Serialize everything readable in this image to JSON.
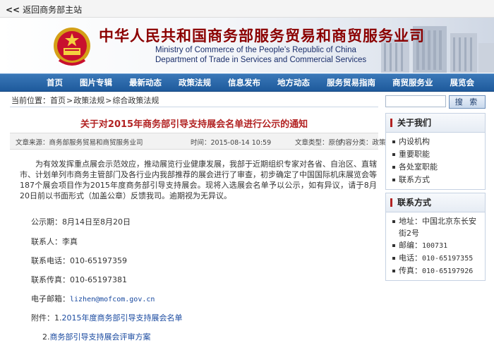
{
  "topbar": {
    "back_label": "返回商务部主站"
  },
  "header": {
    "title_cn": "中华人民共和国商务部服务贸易和商贸服务业司",
    "title_en_line1": "Ministry of Commerce of the People’s Republic of China",
    "title_en_line2": "Department of Trade in Services and Commercial Services"
  },
  "nav": {
    "items": [
      "首页",
      "图片专辑",
      "最新动态",
      "政策法规",
      "信息发布",
      "地方动态",
      "服务贸易指南",
      "商贸服务业",
      "展览会"
    ]
  },
  "breadcrumb": {
    "prefix": "当前位置：",
    "items": [
      "首页",
      "政策法规",
      "综合政策法规"
    ],
    "sep": ">"
  },
  "search": {
    "button_label": "搜 索",
    "placeholder": ""
  },
  "article": {
    "title": "关于对2015年商务部引导支持展会名单进行公示的通知",
    "source": "文章来源：商务部服务贸易和商贸服务业司",
    "time": "时间：2015-08-14 10:59",
    "type": "文章类型：原创",
    "category": "内容分类：政策",
    "body": "为有效发挥重点展会示范效应，推动展览行业健康发展，我部于近期组织专家对各省、自治区、直辖市、计划单列市商务主管部门及各行业内我部推荐的展会进行了审查，初步确定了中国国际机床展览会等187个展会项目作为2015年度商务部引导支持展会。现将入选展会名单予以公示，如有异议，请于8月20日前以书面形式（加盖公章）反馈我司。逾期视为无异议。",
    "period": "公示期：8月14日至8月20日",
    "contact": "联系人：李真",
    "phone": "联系电话：010-65197359",
    "fax": "联系传真：010-65197381",
    "email_label": "电子邮箱：",
    "email": "lizhen@mofcom.gov.cn",
    "attach_label": "附件：1.",
    "attach1": "2015年度商务部引导支持展会名单",
    "attach2_prefix": "2.",
    "attach2": "商务部引导支持展会评审方案"
  },
  "sidebar": {
    "about": {
      "title": "关于我们",
      "items": [
        "内设机构",
        "重要职能",
        "各处室职能",
        "联系方式"
      ]
    },
    "contact": {
      "title": "联系方式",
      "address": "地址：中国北京东长安街2号",
      "postcode_label": "邮编：",
      "postcode": "100731",
      "phone_label": "电话：",
      "phone": "010-65197355",
      "fax_label": "传真：",
      "fax": "010-65197926"
    }
  },
  "colors": {
    "nav_bg": "#2a69ab",
    "title_red": "#b22222",
    "banner_title": "#8b0000"
  }
}
